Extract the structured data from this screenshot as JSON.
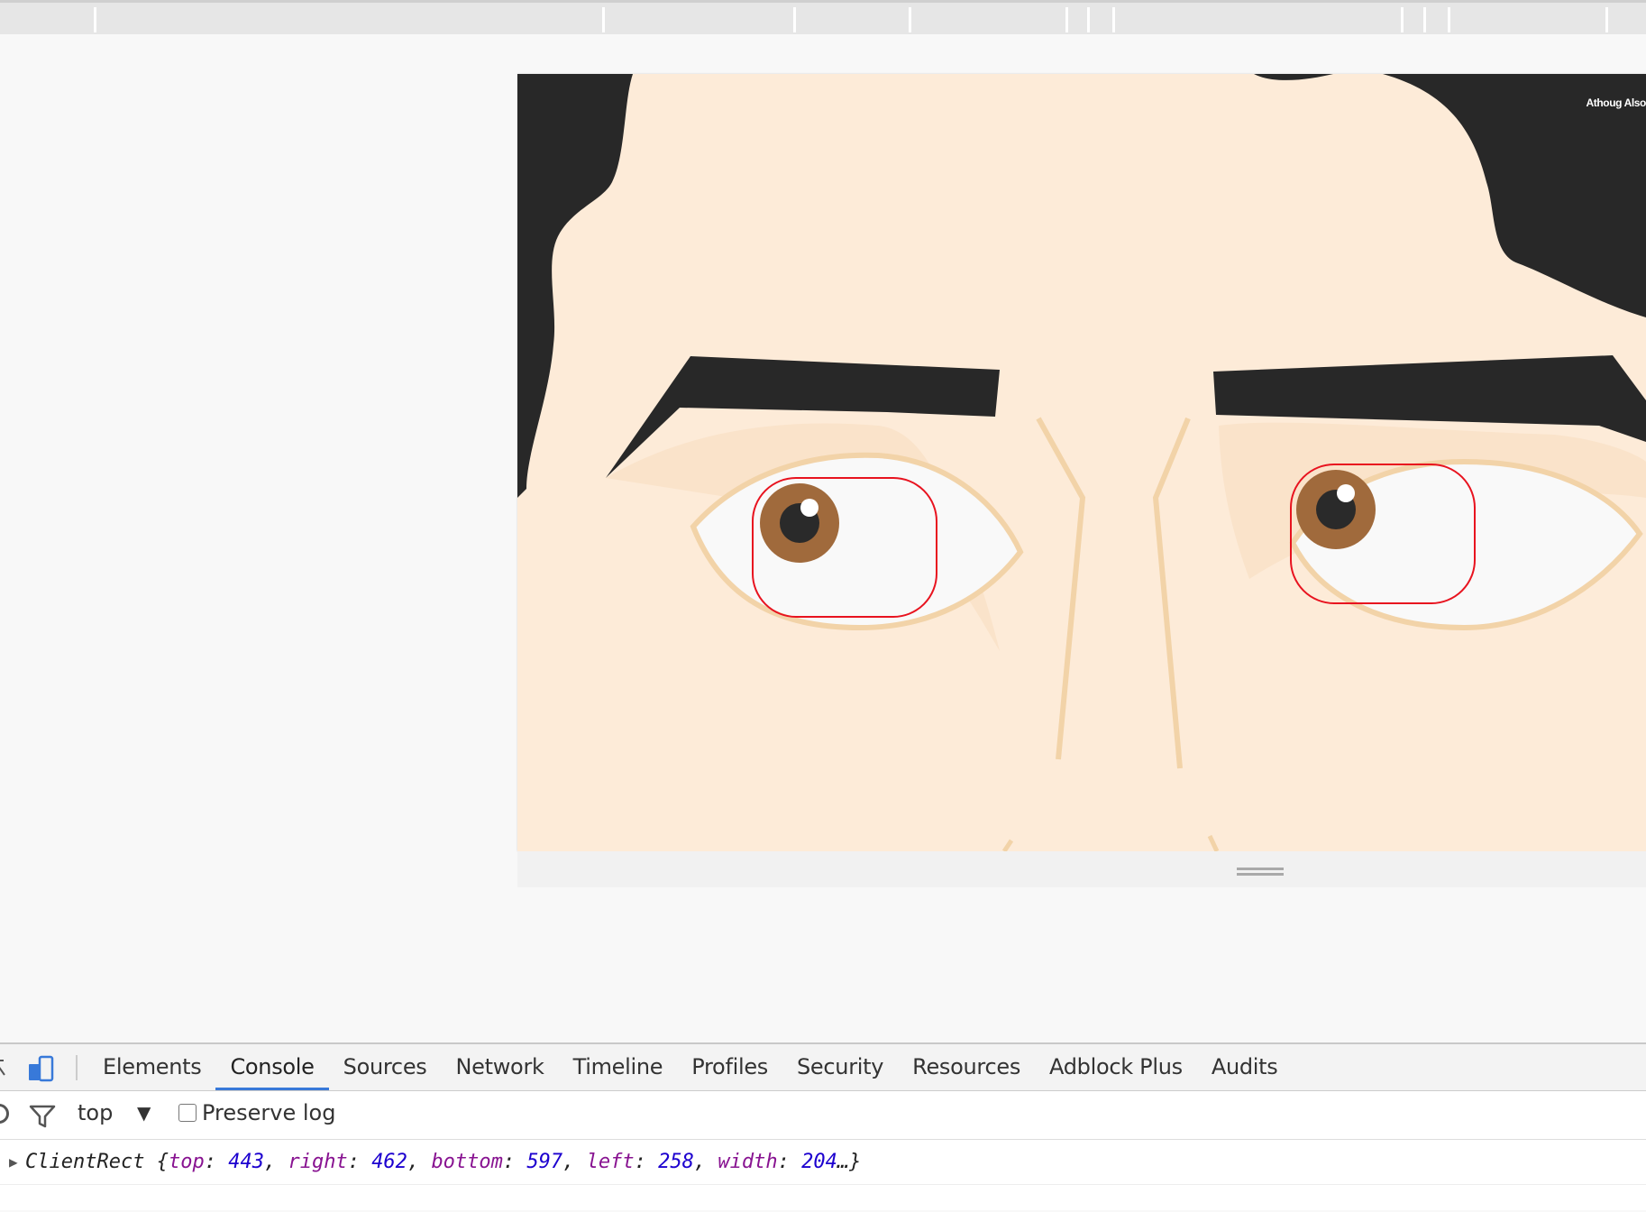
{
  "viewport": {
    "caption": "Athoug Also"
  },
  "devtools": {
    "tabs": [
      {
        "label": "Elements",
        "active": false
      },
      {
        "label": "Console",
        "active": true
      },
      {
        "label": "Sources",
        "active": false
      },
      {
        "label": "Network",
        "active": false
      },
      {
        "label": "Timeline",
        "active": false
      },
      {
        "label": "Profiles",
        "active": false
      },
      {
        "label": "Security",
        "active": false
      },
      {
        "label": "Resources",
        "active": false
      },
      {
        "label": "Adblock Plus",
        "active": false
      },
      {
        "label": "Audits",
        "active": false
      }
    ],
    "toolbar": {
      "context": "top",
      "context_arrow": "▼",
      "preserve_log_label": "Preserve log",
      "preserve_log_checked": false
    },
    "console": {
      "expand_arrow": "▶",
      "object_type": "ClientRect",
      "open_brace": "{",
      "close": "…}",
      "props": [
        {
          "key": "top",
          "value": "443"
        },
        {
          "key": "right",
          "value": "462"
        },
        {
          "key": "bottom",
          "value": "597"
        },
        {
          "key": "left",
          "value": "258"
        },
        {
          "key": "width",
          "value": "204"
        }
      ]
    },
    "icons": {
      "inspect": "inspect-icon",
      "device": "device-mode-icon",
      "clear": "clear-console-icon",
      "filter": "filter-icon"
    }
  },
  "colors": {
    "skin": "#fdebd8",
    "hair": "#282828",
    "iris": "#a06a3c",
    "outline": "#f2d3a8",
    "highlight_box": "#e8131f",
    "active_tab": "#3879d9"
  }
}
